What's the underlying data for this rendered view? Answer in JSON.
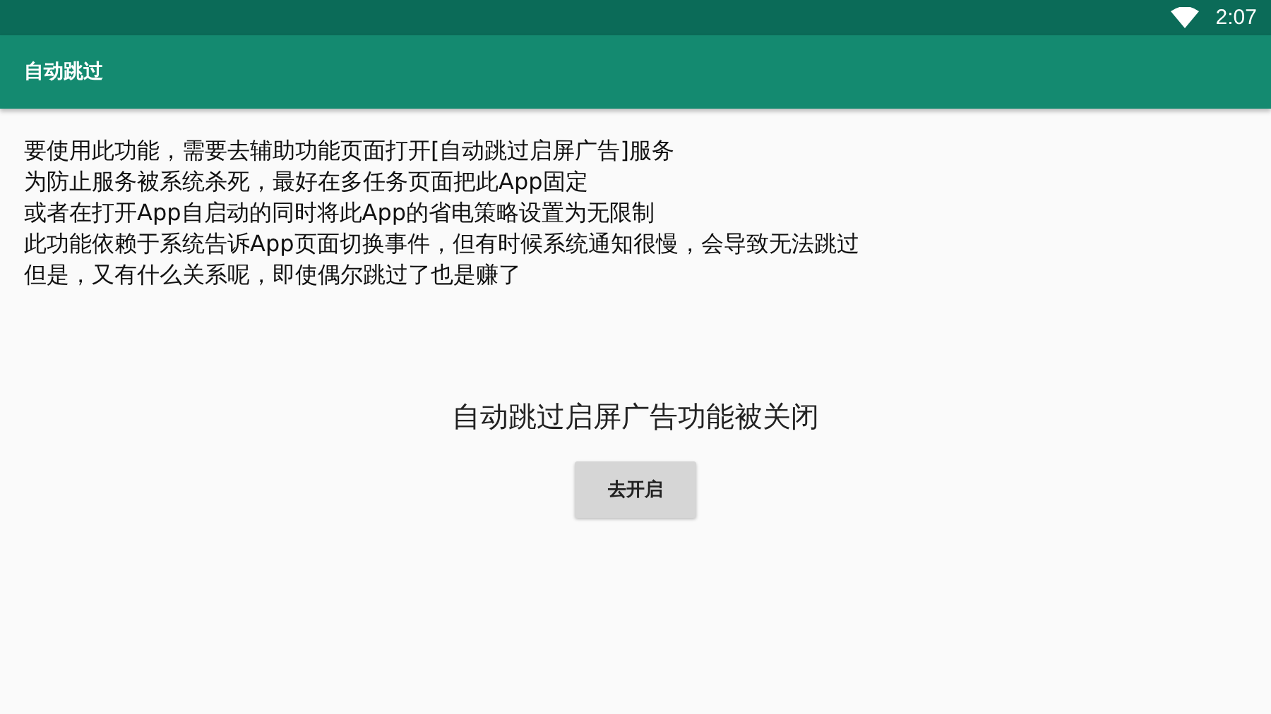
{
  "status_bar": {
    "time": "2:07"
  },
  "app_bar": {
    "title": "自动跳过"
  },
  "notice_lines": [
    "要使用此功能，需要去辅助功能页面打开[自动跳过启屏广告]服务",
    "为防止服务被系统杀死，最好在多任务页面把此App固定",
    "或者在打开App自启动的同时将此App的省电策略设置为无限制",
    "此功能依赖于系统告诉App页面切换事件，但有时候系统通知很慢，会导致无法跳过",
    "但是，又有什么关系呢，即使偶尔跳过了也是赚了"
  ],
  "status_message": "自动跳过启屏广告功能被关闭",
  "action_button": "去开启"
}
